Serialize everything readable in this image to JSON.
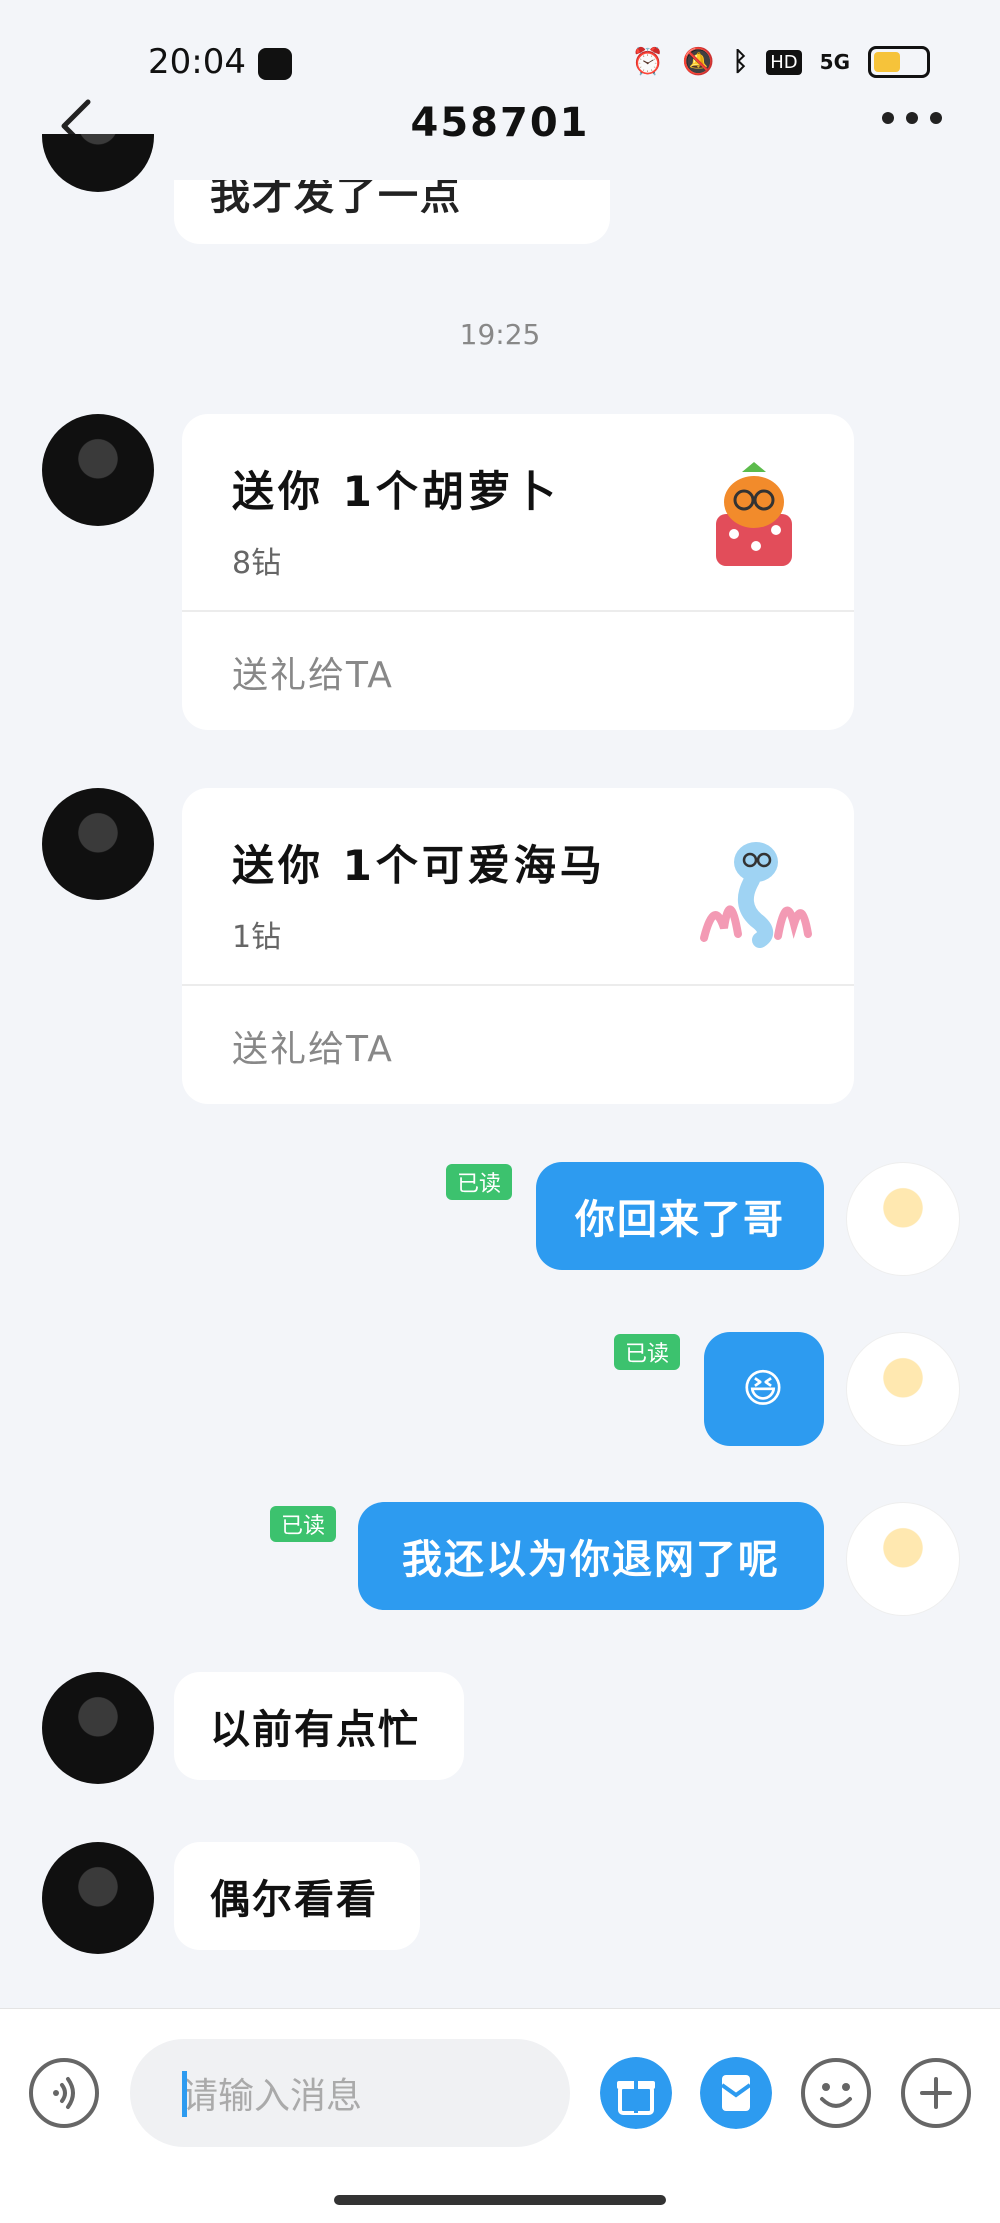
{
  "status_bar": {
    "time": "20:04",
    "icons": [
      "alarm-icon",
      "mute-icon",
      "bluetooth-icon",
      "hd-icon",
      "5g-signal-icon",
      "battery-icon"
    ],
    "network_label": "5G",
    "hd_label": "HD"
  },
  "header": {
    "title": "458701"
  },
  "messages": {
    "partial_top_text": "我才发了一点",
    "timestamp": "19:25",
    "gift1": {
      "title": "送你 1个胡萝卜",
      "price": "8钻",
      "action": "送礼给TA"
    },
    "gift2": {
      "title": "送你 1个可爱海马",
      "price": "1钻",
      "action": "送礼给TA"
    },
    "out1": {
      "text": "你回来了哥",
      "read": "已读"
    },
    "out2": {
      "text": "😆",
      "read": "已读"
    },
    "out3": {
      "text": "我还以为你退网了呢",
      "read": "已读"
    },
    "in1": {
      "text": "以前有点忙"
    },
    "in2": {
      "text": "偶尔看看"
    }
  },
  "composer": {
    "placeholder": "请输入消息"
  },
  "colors": {
    "accent": "#2d9bf0",
    "read_badge": "#3cc26e",
    "background": "#f3f5f9"
  }
}
